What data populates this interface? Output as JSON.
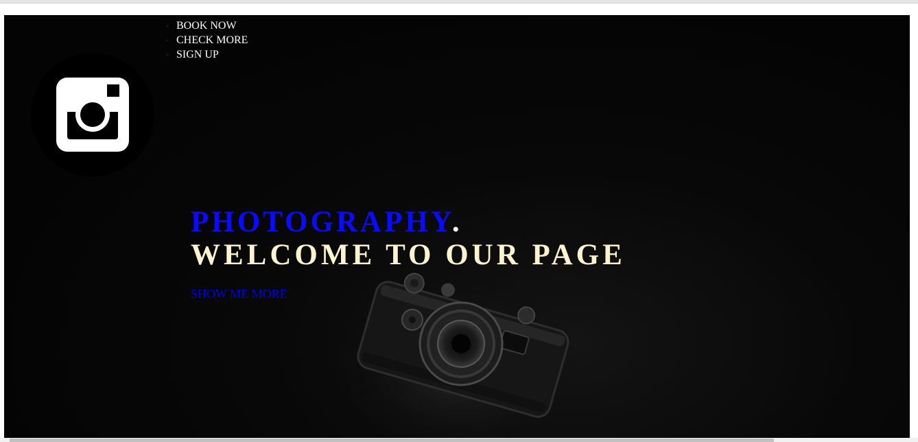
{
  "nav": {
    "items": [
      {
        "label": "BOOK NOW"
      },
      {
        "label": "CHECK MORE"
      },
      {
        "label": "SIGN UP"
      }
    ]
  },
  "logo": {
    "icon": "instagram-icon"
  },
  "hero": {
    "title_accent": "PHOTOGRAPHY",
    "title_dot": ".",
    "subtitle": "WELCOME TO OUR PAGE",
    "cta_label": "SHOW ME MORE"
  },
  "colors": {
    "accent": "#0a0aff",
    "subtitle": "#fdf4cf",
    "link": "#0000ee",
    "background": "#050505"
  }
}
